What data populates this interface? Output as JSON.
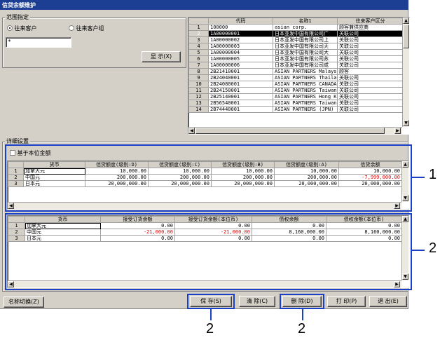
{
  "window": {
    "title": "信贷余额维护"
  },
  "range_group": {
    "label": "范围指定",
    "radio_customer": "往来客户",
    "radio_customer_group": "往来客户组",
    "input_value": "*",
    "show_button": "显 示(X)"
  },
  "customer_list": {
    "headers": [
      "",
      "代码",
      "名称1",
      "往来客户区分"
    ],
    "rows": [
      [
        "1",
        "100000",
        "asian corp.",
        "顾客兼供应商"
      ],
      [
        "2",
        "1A00000001",
        "日本亚发中国有限公司广",
        "关联公司"
      ],
      [
        "3",
        "1A00000002",
        "日本亚发中国有限公司上",
        "关联公司"
      ],
      [
        "4",
        "1A00000003",
        "日本亚发中国有限公司天",
        "关联公司"
      ],
      [
        "5",
        "1A00000004",
        "日本亚发中国有限公司大",
        "关联公司"
      ],
      [
        "6",
        "1A00000005",
        "日本亚发中国有限公司苏",
        "关联公司"
      ],
      [
        "7",
        "1A00000006",
        "日本亚发中国有限公司成",
        "关联公司"
      ],
      [
        "8",
        "2B21410001",
        "ASIAN PARTNERS Malaysi",
        "顾客"
      ],
      [
        "9",
        "2B24040001",
        "ASIAN PARTNERS Thailan",
        "关联公司"
      ],
      [
        "10",
        "2B24080001",
        "ASIAN PARTNERS CANADA",
        "关联公司"
      ],
      [
        "11",
        "2B24150001",
        "ASIAN PARTNERS Taiwan",
        "关联公司"
      ],
      [
        "12",
        "2B25140001",
        "ASIAN PARTNERS Hong K",
        "关联公司"
      ],
      [
        "13",
        "2B56540001",
        "ASIAN PARTNERS Taiwan",
        "关联公司"
      ],
      [
        "14",
        "2B74440001",
        "ASIAN PARTNERS (JPN)",
        "关联公司"
      ]
    ],
    "selected_row": 1
  },
  "detail_group": {
    "label": "详细设置",
    "base_currency_checkbox": "基于本位金额"
  },
  "credit_grid": {
    "headers": [
      "",
      "货币",
      "信贷额度(级别:D)",
      "信贷额度(级别:C)",
      "信贷额度(级别:B)",
      "信贷额度(级别:A)",
      "信贷余额"
    ],
    "rows": [
      [
        "1",
        "加拿大元",
        "10,000.00",
        "10,000.00",
        "10,000.00",
        "10,000.00",
        "10,000.00"
      ],
      [
        "2",
        "中国元",
        "200,000.00",
        "200,000.00",
        "200,000.00",
        "200,000.00",
        "-7,999,000.00"
      ],
      [
        "3",
        "日本元",
        "20,000,000.00",
        "20,000,000.00",
        "20,000,000.00",
        "20,000,000.00",
        "20,000,000.00"
      ]
    ]
  },
  "balance_grid": {
    "headers": [
      "",
      "货币",
      "接受订货余额",
      "接受订货余额(本位币)",
      "债权余额",
      "债权余额(本位币)"
    ],
    "rows": [
      [
        "1",
        "加拿大元",
        "0.00",
        "0.00",
        "0.00",
        "0.00"
      ],
      [
        "2",
        "中国元",
        "-21,000.00",
        "-21,000.00",
        "8,160,000.00",
        "8,160,000.00"
      ],
      [
        "3",
        "日本元",
        "0.00",
        "0.00",
        "0.00",
        "0.00"
      ]
    ]
  },
  "buttons": {
    "name_switch": "名称切换(Z)",
    "save": "保 存(S)",
    "clear": "清 除(C)",
    "delete": "删 除(D)",
    "print": "打 印(P)",
    "exit": "退 出(E)"
  },
  "callouts": {
    "one": "1",
    "two": "2"
  },
  "colors": {
    "title_bar": "#1c3f94",
    "callout_box": "#1a3fc8",
    "negative": "#e00000"
  }
}
